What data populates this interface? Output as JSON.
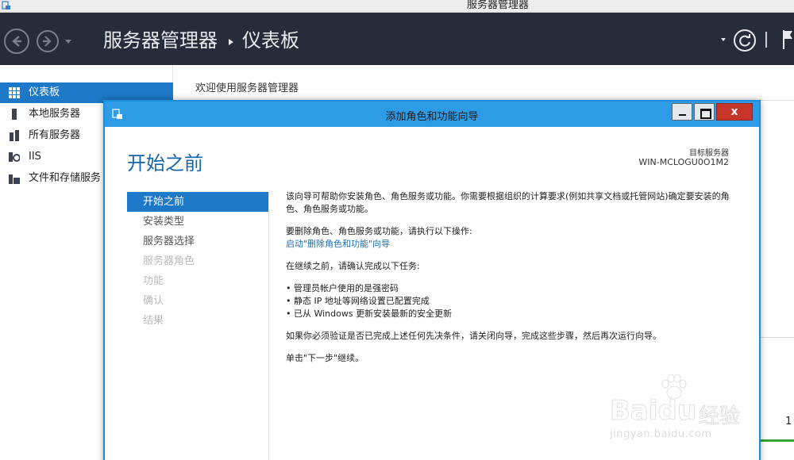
{
  "window": {
    "title": "服务器管理器"
  },
  "header": {
    "breadcrumb_root": "服务器管理器",
    "breadcrumb_current": "仪表板"
  },
  "sidebar": {
    "items": [
      {
        "label": "仪表板",
        "icon": "dashboard-icon",
        "selected": true
      },
      {
        "label": "本地服务器",
        "icon": "server-icon"
      },
      {
        "label": "所有服务器",
        "icon": "servers-icon"
      },
      {
        "label": "IIS",
        "icon": "iis-icon"
      },
      {
        "label": "文件和存储服务",
        "icon": "file-storage-icon"
      }
    ]
  },
  "main": {
    "welcome": "欢迎使用服务器管理器",
    "tile_number": "1"
  },
  "wizard": {
    "title": "添加角色和功能向导",
    "heading": "开始之前",
    "target_label": "目标服务器",
    "target_value": "WIN-MCLOGU0O1M2",
    "steps": [
      {
        "label": "开始之前",
        "state": "current"
      },
      {
        "label": "安装类型",
        "state": "enabled"
      },
      {
        "label": "服务器选择",
        "state": "enabled"
      },
      {
        "label": "服务器角色",
        "state": "disabled"
      },
      {
        "label": "功能",
        "state": "disabled"
      },
      {
        "label": "确认",
        "state": "disabled"
      },
      {
        "label": "结果",
        "state": "disabled"
      }
    ],
    "body": {
      "intro": "该向导可帮助你安装角色、角色服务或功能。你需要根据组织的计算要求(例如共享文档或托管网站)确定要安装的角色、角色服务或功能。",
      "remove_text": "要删除角色、角色服务或功能，请执行以下操作:",
      "remove_link": "启动\"删除角色和功能\"向导",
      "confirm_text": "在继续之前，请确认完成以下任务:",
      "tasks": [
        "管理员帐户使用的是强密码",
        "静态 IP 地址等网络设置已配置完成",
        "已从 Windows 更新安装最新的安全更新"
      ],
      "verify_text": "如果你必须验证是否已完成上述任何先决条件，请关闭向导，完成这些步骤，然后再次运行向导。",
      "next_text": "单击\"下一步\"继续。"
    }
  },
  "watermark": {
    "brand": "Bai",
    "brand2": "du",
    "suffix": "经验",
    "url": "jingyan.baidu.com"
  }
}
